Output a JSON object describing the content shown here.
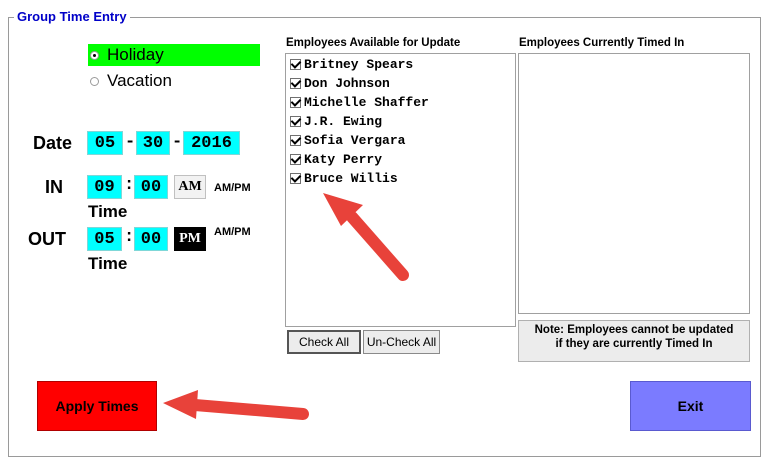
{
  "window": {
    "title": "Group Time Entry"
  },
  "type_options": [
    {
      "label": "Holiday",
      "selected": true
    },
    {
      "label": "Vacation",
      "selected": false
    }
  ],
  "date": {
    "label": "Date",
    "month": "05",
    "day": "30",
    "year": "2016",
    "sep": "-"
  },
  "time_in": {
    "label": "IN",
    "hour": "09",
    "minute": "00",
    "ampm": "AM",
    "ampm_caption": "AM/PM",
    "time_caption": "Time"
  },
  "time_out": {
    "label": "OUT",
    "hour": "05",
    "minute": "00",
    "ampm": "PM",
    "ampm_caption": "AM/PM",
    "time_caption": "Time"
  },
  "time_sep": ":",
  "available": {
    "header": "Employees Available for Update",
    "employees": [
      "Britney Spears",
      "Don Johnson",
      "Michelle Shaffer",
      "J.R. Ewing",
      "Sofia Vergara",
      "Katy Perry",
      "Bruce Willis"
    ]
  },
  "timed_in": {
    "header": "Employees Currently Timed In",
    "employees": []
  },
  "buttons": {
    "check_all": "Check All",
    "uncheck_all": "Un-Check All",
    "apply": "Apply Times",
    "exit": "Exit"
  },
  "note": {
    "line1": "Note: Employees cannot be updated",
    "line2": "if they are currently Timed In"
  },
  "colors": {
    "selected_option": "#00ff00",
    "field": "#00ffff",
    "apply": "#ff0000",
    "exit": "#7b7bff",
    "title": "#0000c8",
    "arrow": "#e8423a"
  }
}
